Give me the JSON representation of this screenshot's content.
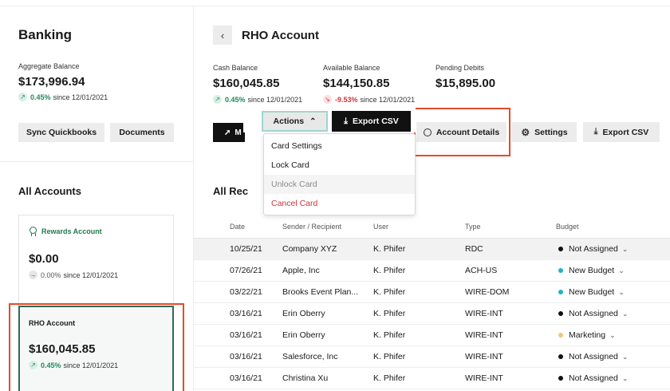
{
  "left": {
    "title": "Banking",
    "aggregate_label": "Aggregate Balance",
    "aggregate_value": "$173,996.94",
    "aggregate_pct": "0.45%",
    "aggregate_since": "since 12/01/2021",
    "sync_label": "Sync Quickbooks",
    "documents_label": "Documents",
    "all_accounts_label": "All Accounts",
    "accounts": [
      {
        "name": "Rewards Account",
        "value": "$0.00",
        "pct": "0.00%",
        "since": "since 12/01/2021"
      },
      {
        "name": "RHO Account",
        "value": "$160,045.85",
        "pct": "0.45%",
        "since": "since 12/01/2021"
      }
    ]
  },
  "header": {
    "account_title": "RHO Account",
    "back_icon": "chevron-left-icon"
  },
  "stats": [
    {
      "label": "Cash Balance",
      "value": "$160,045.85",
      "pct": "0.45%",
      "since": "since 12/01/2021"
    },
    {
      "label": "Available Balance",
      "value": "$144,150.85",
      "pct": "-9.53%",
      "since": "since 12/01/2021"
    },
    {
      "label": "Pending Debits",
      "value": "$15,895.00"
    }
  ],
  "toolbar": {
    "dark_button_label": "M",
    "actions_label": "Actions",
    "export_label": "Export CSV",
    "account_details_label": "Account Details",
    "settings_label": "Settings",
    "export_label_2": "Export CSV"
  },
  "dropdown": {
    "items": [
      "Card Settings",
      "Lock Card",
      "Unlock Card",
      "Cancel Card"
    ]
  },
  "records": {
    "title": "All Rec",
    "columns": [
      "Date",
      "Sender / Recipient",
      "User",
      "Type",
      "Budget"
    ],
    "rows": [
      {
        "date": "10/25/21",
        "party": "Company XYZ",
        "user": "K. Phifer",
        "type": "RDC",
        "budget": "Not Assigned",
        "dot": "#111111"
      },
      {
        "date": "07/26/21",
        "party": "Apple, Inc",
        "user": "K. Phifer",
        "type": "ACH-US",
        "budget": "New Budget",
        "dot": "#1fb4c4"
      },
      {
        "date": "03/22/21",
        "party": "Brooks Event Plan...",
        "user": "K. Phifer",
        "type": "WIRE-DOM",
        "budget": "New Budget",
        "dot": "#1fb4c4"
      },
      {
        "date": "03/16/21",
        "party": "Erin Oberry",
        "user": "K. Phifer",
        "type": "WIRE-INT",
        "budget": "Not Assigned",
        "dot": "#111111"
      },
      {
        "date": "03/16/21",
        "party": "Erin Oberry",
        "user": "K. Phifer",
        "type": "WIRE-INT",
        "budget": "Marketing",
        "dot": "#f5c27a"
      },
      {
        "date": "03/16/21",
        "party": "Salesforce, Inc",
        "user": "K. Phifer",
        "type": "WIRE-INT",
        "budget": "Not Assigned",
        "dot": "#111111"
      },
      {
        "date": "03/16/21",
        "party": "Christina Xu",
        "user": "K. Phifer",
        "type": "WIRE-INT",
        "budget": "Not Assigned",
        "dot": "#111111"
      }
    ]
  },
  "colors": {
    "positive": "#1f8a5b",
    "negative": "#d0343a",
    "highlight_box": "#e34b2a",
    "selected_card_border": "#2f6a58"
  }
}
